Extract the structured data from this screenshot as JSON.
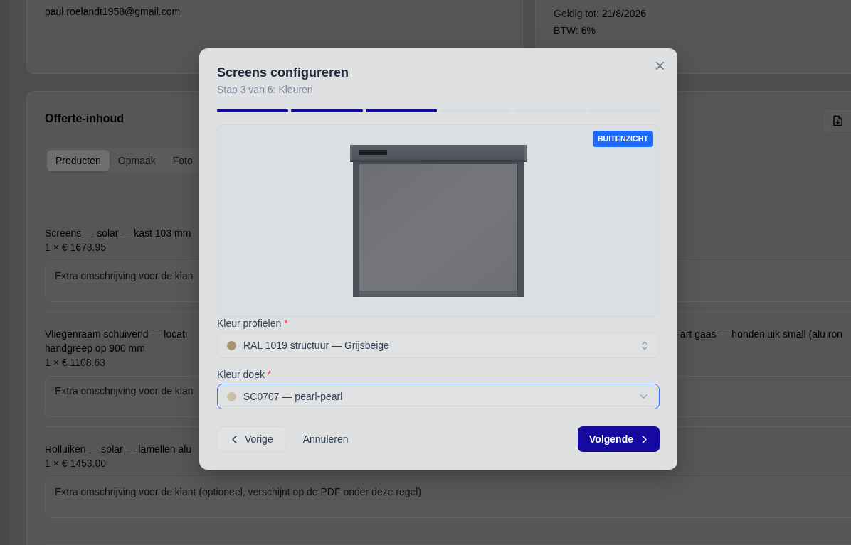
{
  "background": {
    "contact_card": {
      "email": "paul.roelandt1958@gmail.com"
    },
    "quote_card": {
      "details": [
        {
          "label": "Geldig tot:",
          "value": "21/8/2026"
        },
        {
          "label": "BTW:",
          "value": "6%"
        }
      ]
    },
    "content_card": {
      "title": "Offerte-inhoud",
      "tabs": [
        {
          "label": "Producten",
          "selected": true
        },
        {
          "label": "Opmaak",
          "selected": false
        },
        {
          "label": "Foto",
          "selected": false
        }
      ],
      "items": [
        {
          "title_lines": [
            [
              "Screens — solar — kast 103 mm"
            ]
          ],
          "price": "1 × € 1678.95",
          "note_placeholder": "Extra omschrijving voor de klan"
        },
        {
          "title_lines": [
            [
              "Vliegenraam schuivend — locati",
              "art gaas — hondenluik small (alu ron"
            ],
            [
              "handgreep op 900 mm"
            ]
          ],
          "price": "1 × € 1108.63",
          "note_placeholder": "Extra omschrijving voor de klan"
        },
        {
          "title_lines": [
            [
              "Rolluiken — solar — lamellen alu"
            ]
          ],
          "price": "1 × € 1453.00",
          "note_placeholder": "Extra omschrijving voor de klant (optioneel, verschijnt op de PDF onder deze regel)"
        }
      ]
    }
  },
  "dialog": {
    "title": "Screens configureren",
    "subtitle": "Stap 3 van 6: Kleuren",
    "steps": [
      {
        "completed": true
      },
      {
        "completed": true
      },
      {
        "completed": true
      },
      {
        "completed": false
      },
      {
        "completed": false
      },
      {
        "completed": false
      }
    ],
    "preview": {
      "badge": "BUITENZICHT"
    },
    "fields": [
      {
        "kind": "combobox",
        "label": "Kleur profielen",
        "required_mark": "*",
        "value": "RAL 1019 structuur — Grijsbeige",
        "color": "#a89574",
        "focused": false
      },
      {
        "kind": "select",
        "label": "Kleur doek",
        "required_mark": "*",
        "value": "SC0707 — pearl-pearl",
        "color": "#cbbfa8",
        "focused": true
      }
    ],
    "buttons": [
      {
        "kind": "back",
        "label": "Vorige"
      },
      {
        "kind": "cancel",
        "label": "Annuleren"
      },
      {
        "kind": "next",
        "label": "Volgende"
      }
    ]
  }
}
